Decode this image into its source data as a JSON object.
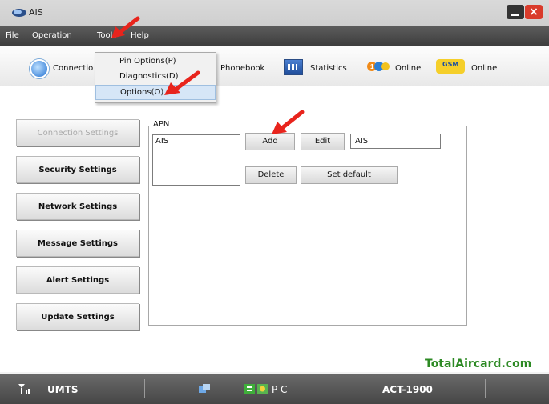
{
  "window": {
    "title": "AIS"
  },
  "menubar": {
    "items": [
      "File",
      "Operation",
      "Tools",
      "Help"
    ]
  },
  "tools_menu": {
    "items": [
      "Pin Options(P)",
      "Diagnostics(D)",
      "Options(O)"
    ],
    "selected_index": 2
  },
  "toolbar": {
    "connection_label": "Connectio",
    "phonebook_label": "Phonebook",
    "statistics_label": "Statistics",
    "online1_label": "Online",
    "online2_label": "Online",
    "online1_icon_text": "1",
    "online2_icon_text": "GSM"
  },
  "sidebar": {
    "items": [
      {
        "label": "Connection Settings",
        "disabled": true
      },
      {
        "label": "Security Settings",
        "disabled": false
      },
      {
        "label": "Network Settings",
        "disabled": false
      },
      {
        "label": "Message Settings",
        "disabled": false
      },
      {
        "label": "Alert Settings",
        "disabled": false
      },
      {
        "label": "Update Settings",
        "disabled": false
      }
    ]
  },
  "apn": {
    "group_label": "APN",
    "list_items": [
      "AIS"
    ],
    "add_label": "Add",
    "edit_label": "Edit",
    "delete_label": "Delete",
    "set_default_label": "Set default",
    "field_value": "AIS"
  },
  "watermark": "TotalAircard.com",
  "statusbar": {
    "signal_icon": "signal-bars-icon",
    "network": "UMTS",
    "mode": "P C",
    "device": "ACT-1900"
  },
  "colors": {
    "annotation_arrow": "#e8241c",
    "watermark": "#2d8a24",
    "close_button": "#d93b2b",
    "selected_menu": "#d6e6f7"
  }
}
